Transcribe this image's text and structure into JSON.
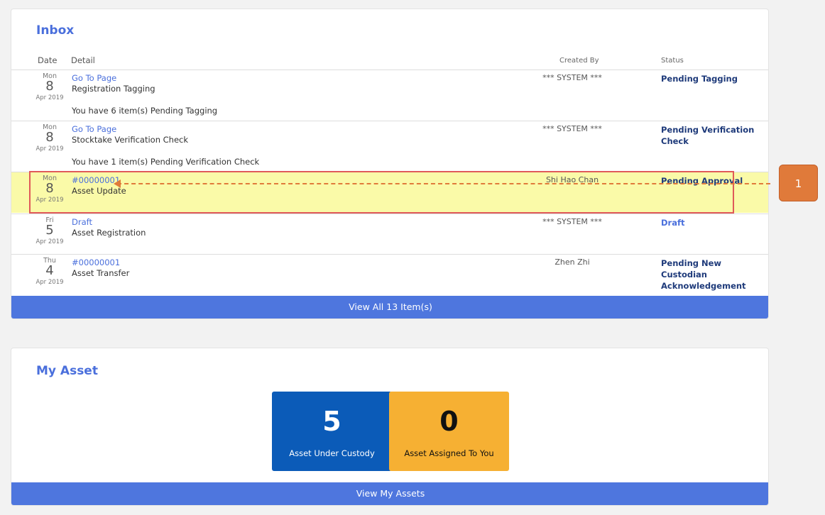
{
  "inbox": {
    "title": "Inbox",
    "columns": {
      "date": "Date",
      "detail": "Detail",
      "created_by": "Created By",
      "status": "Status"
    },
    "rows": [
      {
        "dow": "Mon",
        "day": "8",
        "month_year": "Apr 2019",
        "link": "Go To Page",
        "title": "Registration Tagging",
        "message": "You have 6 item(s) Pending Tagging",
        "created_by": "*** SYSTEM ***",
        "status": "Pending Tagging"
      },
      {
        "dow": "Mon",
        "day": "8",
        "month_year": "Apr 2019",
        "link": "Go To Page",
        "title": "Stocktake Verification Check",
        "message": "You have 1 item(s) Pending Verification Check",
        "created_by": "*** SYSTEM ***",
        "status": "Pending Verification Check"
      },
      {
        "dow": "Mon",
        "day": "8",
        "month_year": "Apr 2019",
        "link": "#00000001",
        "title": "Asset Update",
        "message": "",
        "created_by": "Shi Hao Chan",
        "status": "Pending Approval"
      },
      {
        "dow": "Fri",
        "day": "5",
        "month_year": "Apr 2019",
        "link": "Draft",
        "title": "Asset Registration",
        "message": "",
        "created_by": "*** SYSTEM ***",
        "status": "Draft"
      },
      {
        "dow": "Thu",
        "day": "4",
        "month_year": "Apr 2019",
        "link": "#00000001",
        "title": "Asset Transfer",
        "message": "",
        "created_by": "Zhen Zhi",
        "status": "Pending New Custodian Acknowledgement"
      }
    ],
    "view_all_label": "View All 13 Item(s)"
  },
  "my_asset": {
    "title": "My Asset",
    "tiles": [
      {
        "count": "5",
        "label": "Asset Under Custody",
        "color": "#0b5bb8"
      },
      {
        "count": "0",
        "label": "Asset Assigned To You",
        "color": "#f6b033"
      }
    ],
    "view_label": "View My Assets"
  },
  "annotation": {
    "callout_number": "1",
    "color": "#e07a3a"
  }
}
